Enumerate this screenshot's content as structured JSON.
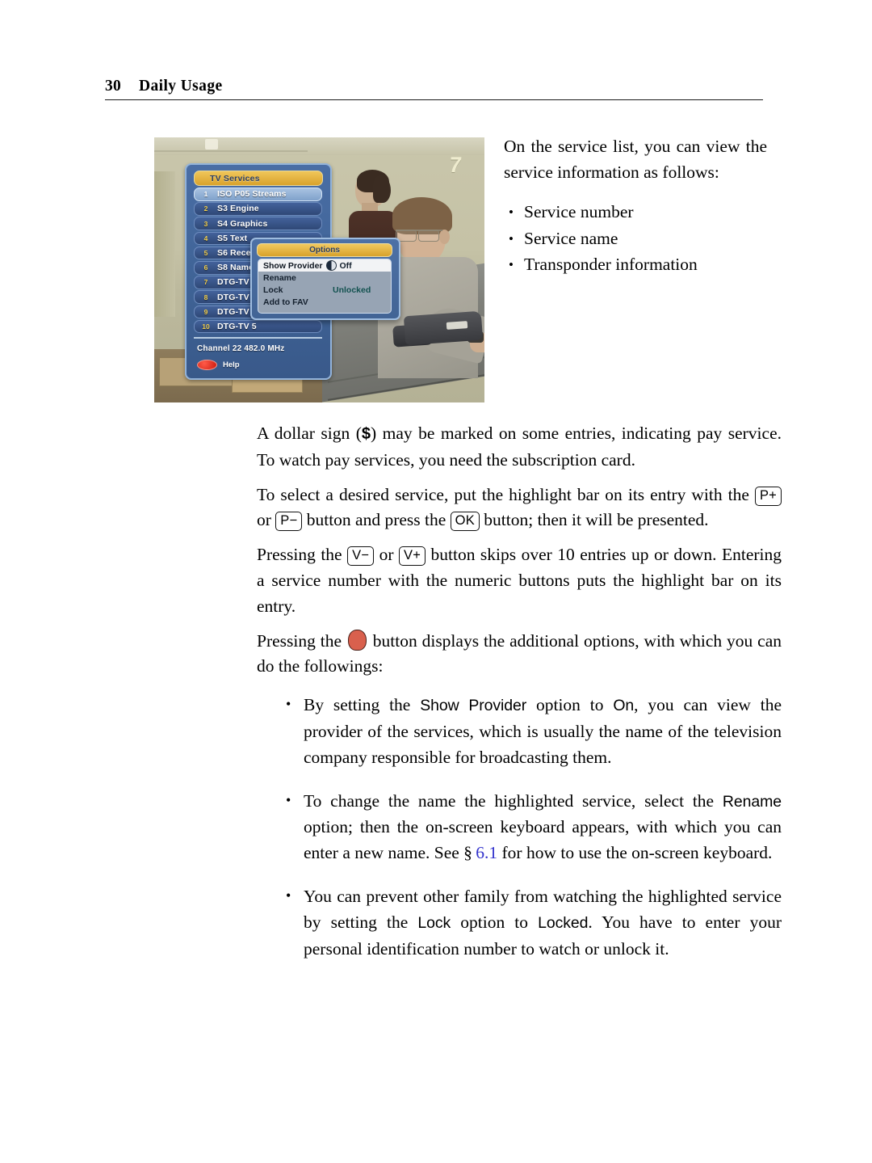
{
  "header": {
    "page_number": "30",
    "chapter_title": "Daily Usage"
  },
  "figure": {
    "name": "tv-screenshot-service-list",
    "station_logo": "7",
    "osd": {
      "list_title": "TV Services",
      "services": [
        {
          "number": "1",
          "name": "ISO P05 Streams",
          "selected": true
        },
        {
          "number": "2",
          "name": "S3 Engine",
          "selected": false
        },
        {
          "number": "3",
          "name": "S4 Graphics",
          "selected": false
        },
        {
          "number": "4",
          "name": "S5 Text",
          "selected": false
        },
        {
          "number": "5",
          "name": "S6 Recei",
          "selected": false
        },
        {
          "number": "6",
          "name": "S8 Name",
          "selected": false
        },
        {
          "number": "7",
          "name": "DTG-TV",
          "selected": false
        },
        {
          "number": "8",
          "name": "DTG-TV",
          "selected": false
        },
        {
          "number": "9",
          "name": "DTG-TV",
          "selected": false
        },
        {
          "number": "10",
          "name": "DTG-TV 5",
          "selected": false
        }
      ],
      "channel_info": "Channel 22  482.0 MHz",
      "help_label": "Help",
      "options_dialog": {
        "title": "Options",
        "rows": [
          {
            "label": "Show Provider",
            "value": "Off",
            "toggle": true,
            "highlighted": true
          },
          {
            "label": "Rename",
            "value": "",
            "toggle": false,
            "highlighted": false
          },
          {
            "label": "Lock",
            "value": "Unlocked",
            "toggle": false,
            "highlighted": false
          },
          {
            "label": "Add to FAV",
            "value": "",
            "toggle": false,
            "highlighted": false
          }
        ]
      }
    }
  },
  "intro": {
    "paragraph": "On the service list, you can view the service information as follows:",
    "bullets": [
      "Service number",
      "Service name",
      "Transponder information"
    ]
  },
  "body": {
    "p_dollar_1": "A dollar sign (",
    "p_dollar_sign": "$",
    "p_dollar_2": ") may be marked on some entries, indicating pay service. To watch pay services, you need the subscription card.",
    "p_select_1": "To select a desired service, put the highlight bar on its entry with the ",
    "key_p_plus": "P+",
    "p_select_2": " or ",
    "key_p_minus": "P−",
    "p_select_3": " button and press the ",
    "key_ok": "OK",
    "p_select_4": " button; then it will be presented.",
    "p_skip_1": "Pressing the ",
    "key_v_minus": "V−",
    "p_skip_2": " or ",
    "key_v_plus": "V+",
    "p_skip_3": " button skips over 10 entries up or down.  Entering a service number with the numeric buttons puts the highlight bar on its entry.",
    "p_red_1": "Pressing the ",
    "red_button_icon": "red-remote-button",
    "p_red_2": " button displays the additional options, with which you can do the followings:"
  },
  "options_bullets": {
    "b1_1": "By setting the ",
    "b1_term1": "Show Provider",
    "b1_2": " option to ",
    "b1_term2": "On",
    "b1_3": ", you can view the provider of the services, which is usually the name of the television company responsible for broadcasting them.",
    "b2_1": "To change the name the highlighted service, select the ",
    "b2_term1": "Rename",
    "b2_2": " option; then the on-screen keyboard appears, with which you can enter a new name. See § ",
    "b2_xref": "6.1",
    "b2_3": " for how to use the on-screen keyboard.",
    "b3_1": "You can prevent other family from watching the highlighted service by setting the ",
    "b3_term1": "Lock",
    "b3_2": " option to ",
    "b3_term2": "Locked",
    "b3_3": ". You have to enter your personal identification number to watch or unlock it."
  },
  "colors": {
    "link": "#3333CC",
    "red_button": "#D9604D",
    "osd_gold": "#E0A832",
    "osd_blue": "#3F6396",
    "osd_highlight": "#A9C3E2"
  }
}
